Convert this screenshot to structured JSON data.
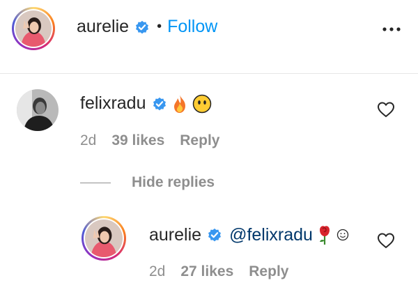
{
  "header": {
    "username": "aurelie",
    "separator": "•",
    "follow_label": "Follow",
    "more_icon": "more-options-icon"
  },
  "comment": {
    "username": "felixradu",
    "emojis": [
      "fire",
      "face-without-mouth"
    ],
    "time": "2d",
    "likes": "39 likes",
    "reply_label": "Reply"
  },
  "replies_toggle": {
    "label": "Hide replies"
  },
  "reply": {
    "username": "aurelie",
    "mention": "@felixradu",
    "emojis": [
      "rose",
      "smiley"
    ],
    "time": "2d",
    "likes": "27 likes",
    "reply_label": "Reply"
  },
  "colors": {
    "link": "#0095f6",
    "mention": "#00376b",
    "verified": "#3897f0",
    "muted": "#8e8e8e",
    "text": "#262626"
  }
}
